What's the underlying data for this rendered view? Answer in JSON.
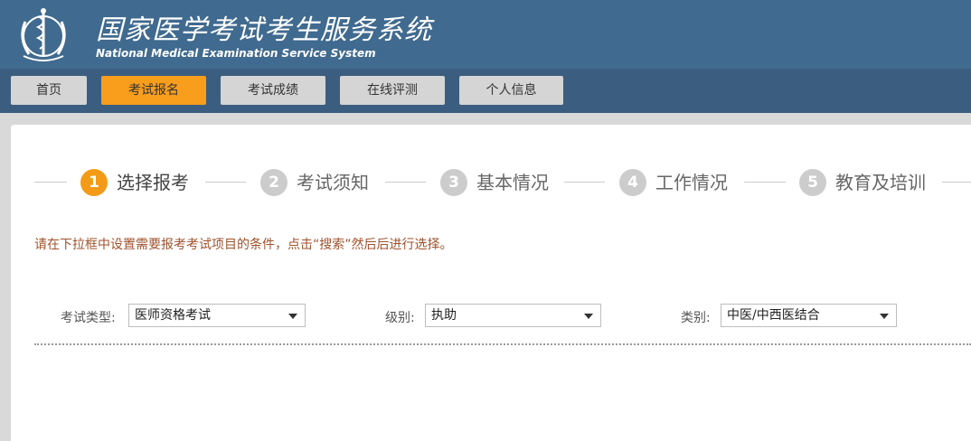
{
  "header": {
    "title_cn": "国家医学考试考生服务系统",
    "title_en": "National Medical Examination Service System"
  },
  "nav": [
    {
      "label": "首页",
      "active": false
    },
    {
      "label": "考试报名",
      "active": true
    },
    {
      "label": "考试成绩",
      "active": false
    },
    {
      "label": "在线评测",
      "active": false
    },
    {
      "label": "个人信息",
      "active": false
    }
  ],
  "steps": [
    {
      "num": "1",
      "label": "选择报考",
      "active": true
    },
    {
      "num": "2",
      "label": "考试须知",
      "active": false
    },
    {
      "num": "3",
      "label": "基本情况",
      "active": false
    },
    {
      "num": "4",
      "label": "工作情况",
      "active": false
    },
    {
      "num": "5",
      "label": "教育及培训",
      "active": false
    }
  ],
  "hint": "请在下拉框中设置需要报考考试项目的条件，点击“搜索”然后后进行选择。",
  "filters": {
    "exam_type": {
      "label": "考试类型:",
      "value": "医师资格考试"
    },
    "level": {
      "label": "级别:",
      "value": "执助"
    },
    "category": {
      "label": "类别:",
      "value": "中医/中西医结合"
    }
  },
  "colors": {
    "header_bg": "#406a8f",
    "nav_bg": "#3b5e80",
    "accent": "#f99d1c",
    "hint_text": "#a0522d"
  }
}
